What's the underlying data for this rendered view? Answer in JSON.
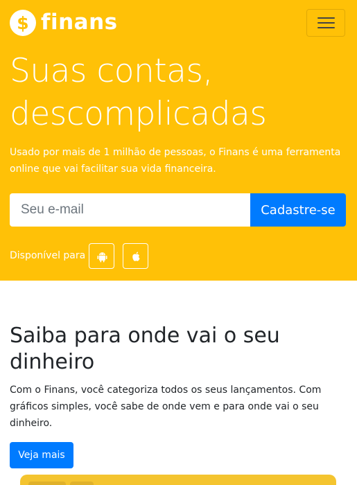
{
  "brand": {
    "name": "finans",
    "icon": "dollar-coin-icon"
  },
  "colors": {
    "hero": "#ffc107",
    "primary": "#007bff",
    "text": "#212529",
    "white": "#ffffff"
  },
  "navbar": {
    "menu_icon": "hamburger-icon"
  },
  "hero": {
    "title_line1": "Suas contas,",
    "title_line2": "descomplicadas",
    "lead": "Usado por mais de 1 milhão de pessoas, o Finans é uma ferramenta online que vai facilitar sua vida financeira."
  },
  "signup": {
    "placeholder": "Seu e-mail",
    "button": "Cadastre-se"
  },
  "availability": {
    "label": "Disponível para",
    "platforms": [
      "android-icon",
      "apple-icon"
    ]
  },
  "feature": {
    "title": "Saiba para onde vai o seu dinheiro",
    "text": "Com o Finans, você categoriza todos os seus lançamentos. Com gráficos simples, você sabe de onde vem e para onde vai o seu dinheiro.",
    "button": "Veja mais"
  }
}
